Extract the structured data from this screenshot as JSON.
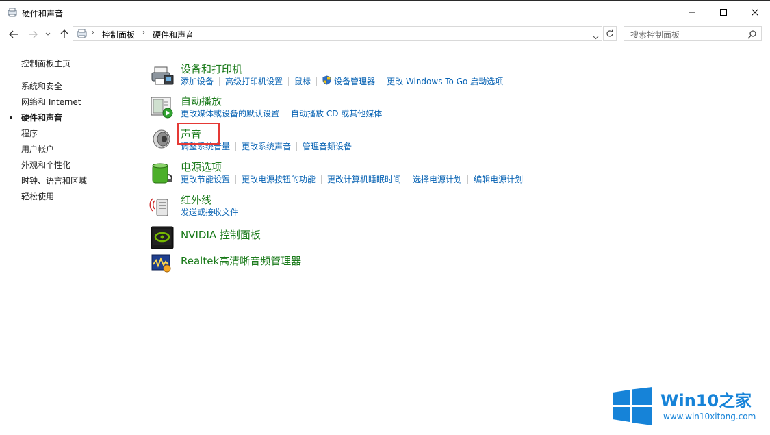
{
  "window": {
    "title": "硬件和声音",
    "minimize_icon": "minimize-icon",
    "maximize_icon": "maximize-icon",
    "close_icon": "close-icon"
  },
  "address_bar": {
    "breadcrumbs": [
      "控制面板",
      "硬件和声音"
    ],
    "search_placeholder": "搜索控制面板"
  },
  "left_nav": {
    "items": [
      {
        "label": "控制面板主页",
        "active": false
      },
      {
        "label": "系统和安全",
        "active": false
      },
      {
        "label": "网络和 Internet",
        "active": false
      },
      {
        "label": "硬件和声音",
        "active": true
      },
      {
        "label": "程序",
        "active": false
      },
      {
        "label": "用户帐户",
        "active": false
      },
      {
        "label": "外观和个性化",
        "active": false
      },
      {
        "label": "时钟、语言和区域",
        "active": false
      },
      {
        "label": "轻松使用",
        "active": false
      }
    ]
  },
  "categories": [
    {
      "title": "设备和打印机",
      "icon": "printer-icon",
      "links": [
        "添加设备",
        "高级打印机设置",
        "鼠标",
        "设备管理器",
        "更改 Windows To Go 启动选项"
      ]
    },
    {
      "title": "自动播放",
      "icon": "autoplay-icon",
      "links": [
        "更改媒体或设备的默认设置",
        "自动播放 CD 或其他媒体"
      ]
    },
    {
      "title": "声音",
      "icon": "speaker-icon",
      "links": [
        "调整系统音量",
        "更改系统声音",
        "管理音频设备"
      ]
    },
    {
      "title": "电源选项",
      "icon": "power-icon",
      "links": [
        "更改节能设置",
        "更改电源按钮的功能",
        "更改计算机睡眠时间",
        "选择电源计划",
        "编辑电源计划"
      ]
    },
    {
      "title": "红外线",
      "icon": "infrared-icon",
      "links": [
        "发送或接收文件"
      ]
    },
    {
      "title": "NVIDIA 控制面板",
      "icon": "nvidia-icon",
      "links": []
    },
    {
      "title": "Realtek高清晰音频管理器",
      "icon": "realtek-icon",
      "links": []
    }
  ],
  "colors": {
    "category_title": "#1a7a1a",
    "link": "#0a64b4",
    "highlight_box": "#e53935",
    "watermark": "#1683d8"
  },
  "watermark": {
    "title": "Win10",
    "title_suffix": "之家",
    "url": "www.win10xitong.com"
  }
}
